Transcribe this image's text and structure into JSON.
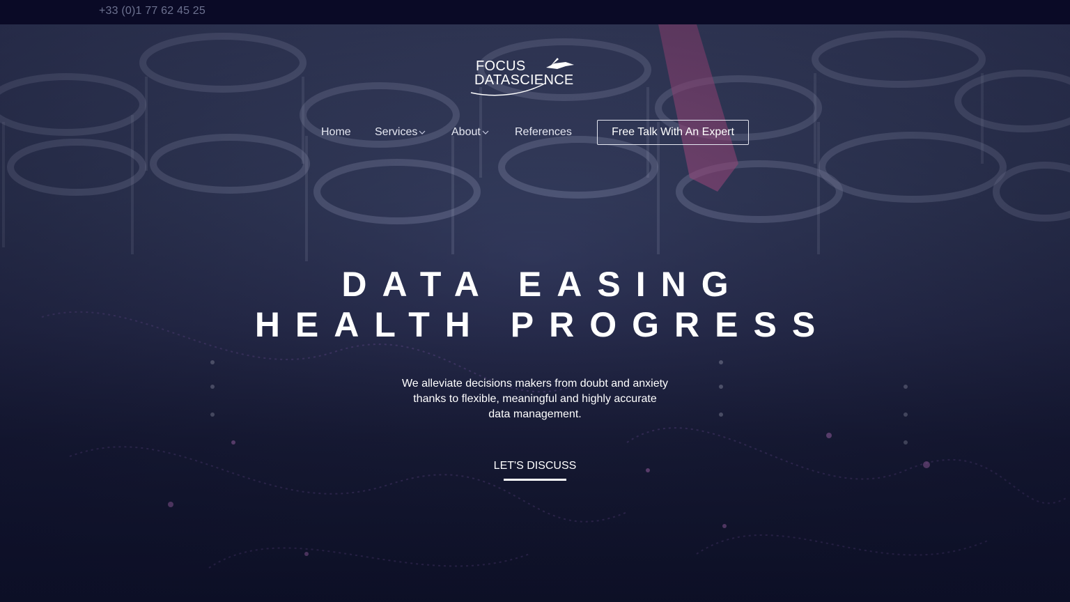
{
  "topbar": {
    "phone": "+33 (0)1 77 62 45 25"
  },
  "logo": {
    "line1": "FOCUS",
    "line2": "DATASCIENCE"
  },
  "nav": {
    "items": [
      {
        "label": "Home"
      },
      {
        "label": "Services"
      },
      {
        "label": "About"
      },
      {
        "label": "References"
      }
    ],
    "cta": "Free Talk With An Expert"
  },
  "hero": {
    "headline_line1": "DATA EASING",
    "headline_line2": "HEALTH PROGRESS",
    "subtext_line1": "We alleviate decisions makers from doubt and anxiety",
    "subtext_line2": "thanks to flexible, meaningful and highly accurate",
    "subtext_line3": "data management.",
    "button": "LET'S DISCUSS"
  },
  "colors": {
    "topbar_bg": "#0a0a26",
    "hero_overlay": "#2a2f52",
    "text": "#ffffff",
    "accent_pink": "#b0508a"
  }
}
